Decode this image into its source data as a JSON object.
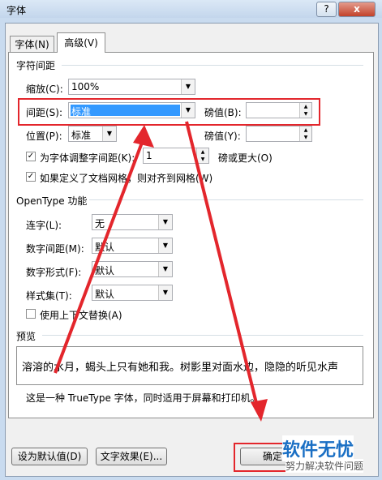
{
  "window": {
    "title": "字体",
    "help": "?",
    "close": "x"
  },
  "tabs": [
    {
      "label": "字体(N)"
    },
    {
      "label": "高级(V)"
    }
  ],
  "spacing": {
    "heading": "字符间距",
    "scale_label": "缩放(C):",
    "scale_value": "100%",
    "spacing_label": "间距(S):",
    "spacing_value": "标准",
    "spacing_by_label": "磅值(B):",
    "spacing_by_value": "",
    "position_label": "位置(P):",
    "position_value": "标准",
    "position_by_label": "磅值(Y):",
    "position_by_value": "",
    "kerning_label": "为字体调整字间距(K):",
    "kerning_value": "1",
    "kerning_suffix": "磅或更大(O)",
    "kerning_checked": true,
    "grid_label": "如果定义了文档网格，则对齐到网格(W)",
    "grid_checked": true
  },
  "opentype": {
    "heading": "OpenType 功能",
    "ligatures_label": "连字(L):",
    "ligatures_value": "无",
    "num_spacing_label": "数字间距(M):",
    "num_spacing_value": "默认",
    "num_forms_label": "数字形式(F):",
    "num_forms_value": "默认",
    "stylistic_label": "样式集(T):",
    "stylistic_value": "默认",
    "contextual_label": "使用上下文替换(A)",
    "contextual_checked": false
  },
  "preview": {
    "heading": "预览",
    "sample": "溶溶的水月，蝎头上只有她和我。树影里对面水边，隐隐的听见水声",
    "note": "这是一种 TrueType 字体，同时适用于屏幕和打印机。"
  },
  "buttons": {
    "default": "设为默认值(D)",
    "effects": "文字效果(E)...",
    "ok": "确定"
  },
  "watermark": {
    "brand": "软件无忧",
    "tagline": "努力解决软件问题"
  },
  "colors": {
    "highlight": "#3399ff",
    "annotation_red": "#e3262c"
  }
}
